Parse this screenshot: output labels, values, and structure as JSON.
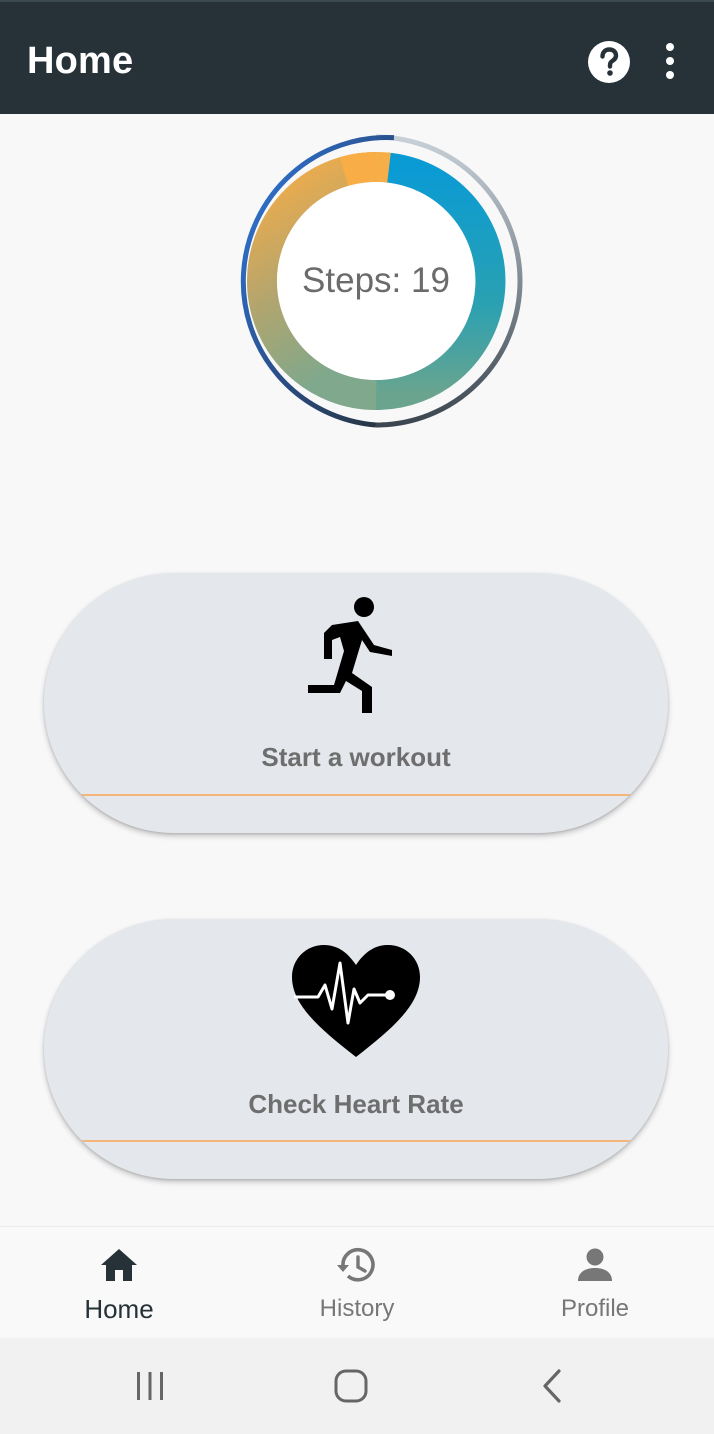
{
  "appbar": {
    "title": "Home",
    "help_icon": "help-circle-icon",
    "more_icon": "more-vert-icon",
    "background": "#263238"
  },
  "progress": {
    "steps_text": "Steps: 19",
    "colors": {
      "orange": "#f9ad46",
      "blue": "#0b9bd4",
      "outer_start": "#2d74da",
      "outer_end": "#263238"
    }
  },
  "cards": {
    "workout": {
      "label": "Start a workout",
      "icon": "running-person-icon"
    },
    "heart": {
      "label": "Check Heart Rate",
      "icon": "heart-pulse-icon"
    },
    "underline_color": "#f3b57a"
  },
  "bottom_nav": {
    "items": [
      {
        "label": "Home",
        "icon": "home-icon",
        "active": true
      },
      {
        "label": "History",
        "icon": "history-icon",
        "active": false
      },
      {
        "label": "Profile",
        "icon": "person-icon",
        "active": false
      }
    ]
  },
  "system_nav": {
    "recents": "recents-icon",
    "home": "home-circle-icon",
    "back": "back-icon"
  }
}
